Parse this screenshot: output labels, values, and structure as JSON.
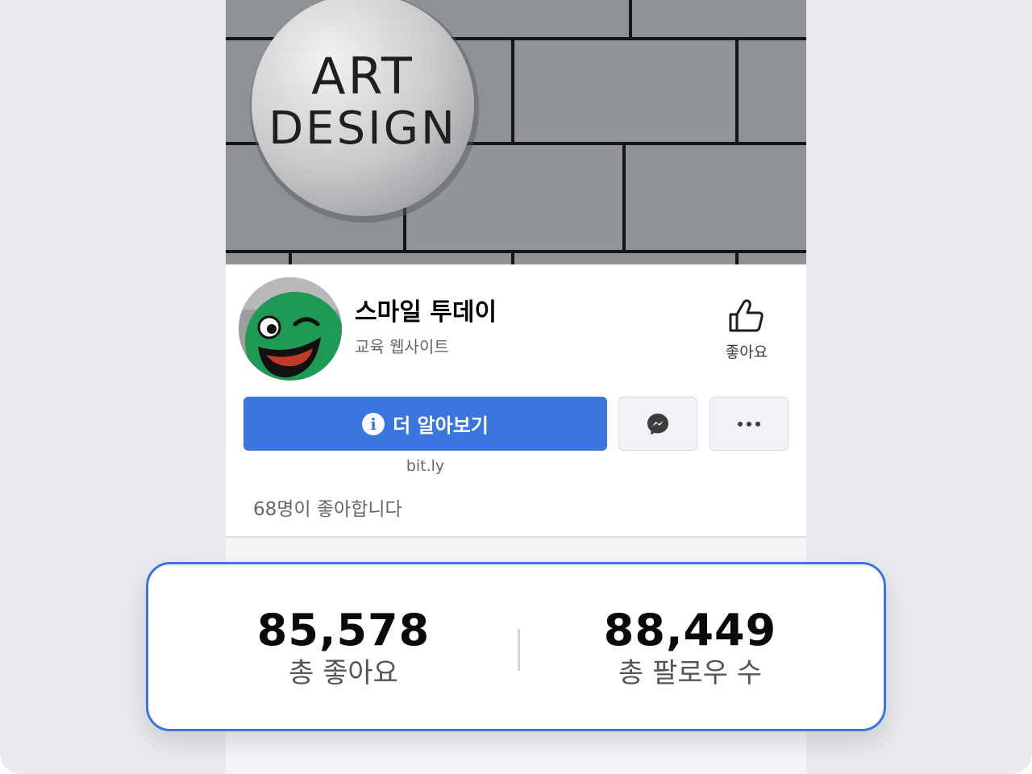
{
  "cover": {
    "logo_lines": [
      "ART",
      "DESIGN"
    ]
  },
  "profile": {
    "name": "스마일 투데이",
    "category": "교육 웹사이트",
    "like_label": "좋아요"
  },
  "actions": {
    "learn_more_label": "더 알아보기",
    "info_glyph": "i",
    "link_caption": "bit.ly",
    "messenger_icon": "messenger-icon",
    "more_icon": "more-icon"
  },
  "likes_summary": "68명이 좋아합니다",
  "stats": {
    "total_likes": {
      "value": "85,578",
      "label": "총 좋아요"
    },
    "total_followers": {
      "value": "88,449",
      "label": "총 팔로우 수"
    }
  },
  "colors": {
    "accent": "#3a76de",
    "background": "#e9eaee",
    "avatar_green": "#1e9a54"
  }
}
